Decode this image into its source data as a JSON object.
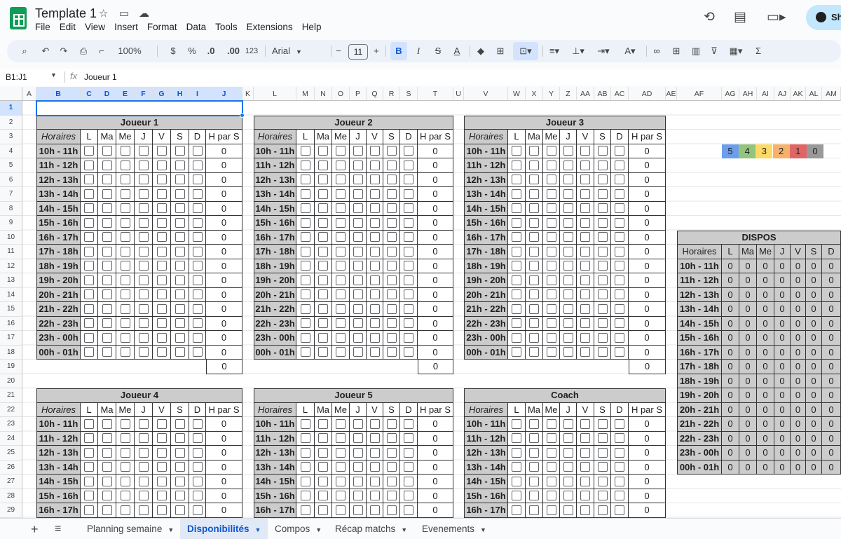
{
  "app": {
    "title": "Template 1"
  },
  "menu": [
    "File",
    "Edit",
    "View",
    "Insert",
    "Format",
    "Data",
    "Tools",
    "Extensions",
    "Help"
  ],
  "share": {
    "label": "Sh"
  },
  "toolbar": {
    "zoom": "100%",
    "currency": "$",
    "percent": "%",
    "dec_decrease": ".0",
    "dec_increase": ".00",
    "format_123": "123",
    "font": "Arial",
    "font_size": "11"
  },
  "formula": {
    "namebox": "B1:J1",
    "fx": "fx",
    "content": "Joueur 1"
  },
  "columns": [
    "A",
    "B",
    "C",
    "D",
    "E",
    "F",
    "G",
    "H",
    "I",
    "J",
    "K",
    "L",
    "M",
    "N",
    "O",
    "P",
    "Q",
    "R",
    "S",
    "T",
    "U",
    "V",
    "W",
    "X",
    "Y",
    "Z",
    "AA",
    "AB",
    "AC",
    "AD",
    "AE",
    "AF",
    "AG",
    "AH",
    "AI",
    "AJ",
    "AK",
    "AL",
    "AM"
  ],
  "rows": [
    "1",
    "2",
    "3",
    "4",
    "5",
    "6",
    "7",
    "8",
    "9",
    "10",
    "11",
    "12",
    "13",
    "14",
    "15",
    "16",
    "17",
    "18",
    "19",
    "20",
    "21",
    "22",
    "23",
    "24",
    "25",
    "26",
    "27",
    "28",
    "29"
  ],
  "days": [
    "L",
    "Ma",
    "Me",
    "J",
    "V",
    "S",
    "D"
  ],
  "horaires_label": "Horaires",
  "hpars_label": "H par S",
  "slots": [
    "10h - 11h",
    "11h - 12h",
    "12h - 13h",
    "13h - 14h",
    "14h - 15h",
    "15h - 16h",
    "16h - 17h",
    "17h - 18h",
    "18h - 19h",
    "19h - 20h",
    "20h - 21h",
    "21h - 22h",
    "22h - 23h",
    "23h - 00h",
    "00h - 01h"
  ],
  "players": [
    "Joueur 1",
    "Joueur 2",
    "Joueur 3",
    "Joueur 4",
    "Joueur 5",
    "Coach"
  ],
  "zero": "0",
  "legend": {
    "values": [
      "5",
      "4",
      "3",
      "2",
      "1",
      "0"
    ],
    "colors": [
      "#6d9eeb",
      "#93c47d",
      "#ffd966",
      "#f6b26b",
      "#e06666",
      "#999999"
    ]
  },
  "dispos": {
    "title": "DISPOS",
    "header": "Horaires"
  },
  "sheets": [
    {
      "label": "Planning semaine"
    },
    {
      "label": "Disponibilités"
    },
    {
      "label": "Compos"
    },
    {
      "label": "Récap matchs"
    },
    {
      "label": "Evenements"
    }
  ],
  "active_sheet": "Disponibilités"
}
